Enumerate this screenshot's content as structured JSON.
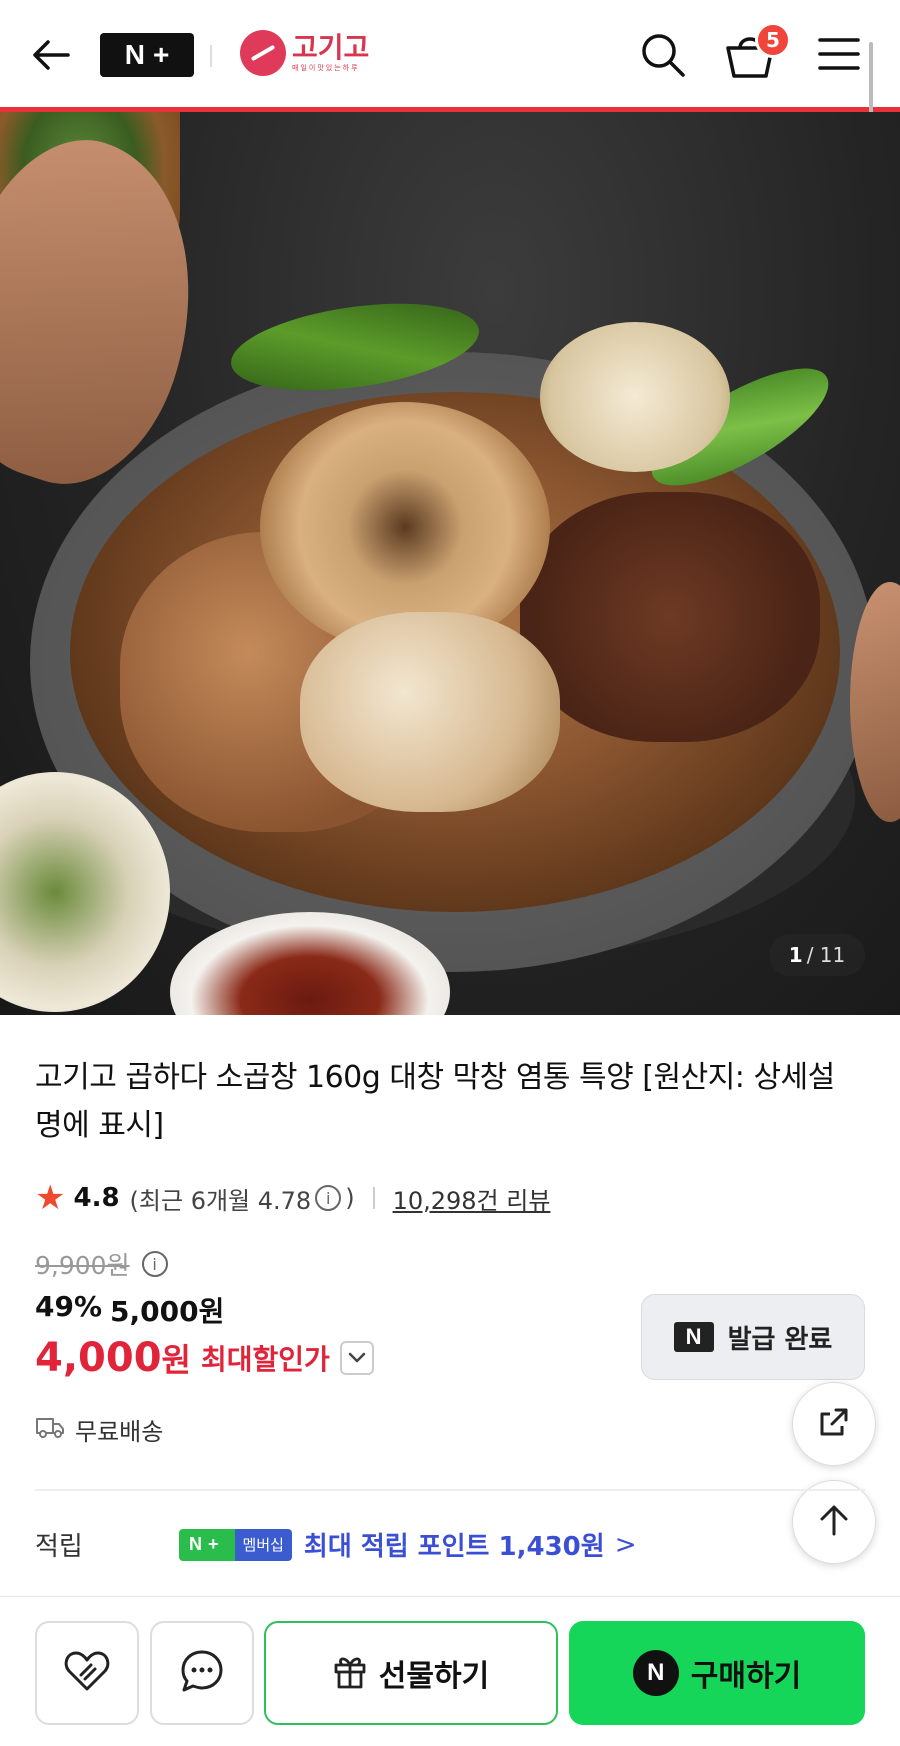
{
  "header": {
    "nplus_n": "N",
    "nplus_plus": "+",
    "brand_name": "고기고",
    "brand_sub": "매일이맛있는하루",
    "cart_count": "5"
  },
  "gallery": {
    "current": "1",
    "total": "/ 11"
  },
  "product": {
    "title": "고기고 곱하다 소곱창 160g 대창 막창 염통 특양 [원산지: 상세설명에 표시]",
    "rating": "4.8",
    "recent_rating": "(최근 6개월 4.78",
    "recent_close": ")",
    "review_count": "10,298건 리뷰",
    "original_price": "9,900원",
    "discount_rate": "49%",
    "sale_price": "5,000원",
    "final_price": "4,000",
    "final_won": "원",
    "final_label": "최대할인가",
    "shipping": "무료배송"
  },
  "coupon": {
    "n": "N",
    "label": "발급 완료"
  },
  "points": {
    "label": "적립",
    "badge_n": "N+",
    "badge_membership": "멤버십",
    "text": "최대 적립 포인트 1,430원",
    "chevron": ">"
  },
  "bottom_bar": {
    "gift_label": "선물하기",
    "buy_n": "N",
    "buy_label": "구매하기"
  },
  "colors": {
    "accent_red": "#e0243a",
    "header_line": "#e8303a",
    "naver_green": "#16d65a",
    "points_blue": "#3b4fd4"
  }
}
